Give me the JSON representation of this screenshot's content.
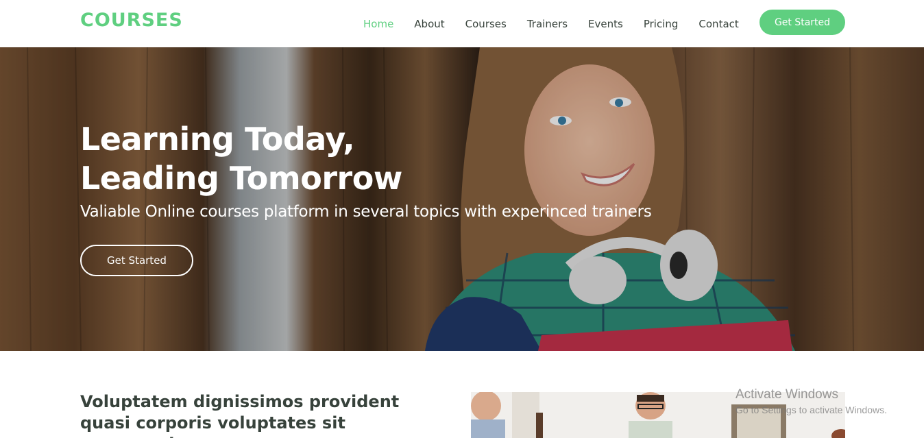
{
  "colors": {
    "accent": "#5fcf80",
    "text": "#37423b",
    "white": "#ffffff"
  },
  "header": {
    "logo": "COURSES",
    "nav": [
      {
        "label": "Home",
        "active": true
      },
      {
        "label": "About"
      },
      {
        "label": "Courses"
      },
      {
        "label": "Trainers"
      },
      {
        "label": "Events"
      },
      {
        "label": "Pricing"
      },
      {
        "label": "Contact"
      }
    ],
    "cta_label": "Get Started"
  },
  "hero": {
    "title_line1": "Learning Today,",
    "title_line2": "Leading Tomorrow",
    "subtitle": "Valiable Online courses platform in several topics with experinced trainers",
    "button_label": "Get Started",
    "image": "student-with-headphones-photo"
  },
  "about": {
    "heading": "Voluptatem dignissimos provident quasi corporis voluptates sit assumenda.",
    "image": "people-in-office-photo"
  },
  "watermark": {
    "title": "Activate Windows",
    "subtitle": "Go to Settings to activate Windows."
  }
}
